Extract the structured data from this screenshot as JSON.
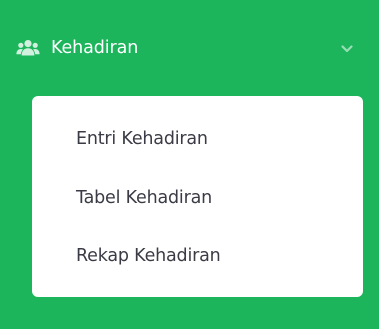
{
  "colors": {
    "sidebar_bg": "#1cb55c",
    "header_text": "#ffffff",
    "submenu_bg": "#ffffff",
    "submenu_text": "#3a3b45"
  },
  "menu": {
    "icon": "users-icon",
    "title": "Kehadiran",
    "expand_icon": "chevron-down-icon",
    "items": [
      {
        "label": "Entri Kehadiran"
      },
      {
        "label": "Tabel Kehadiran"
      },
      {
        "label": "Rekap Kehadiran"
      }
    ]
  }
}
